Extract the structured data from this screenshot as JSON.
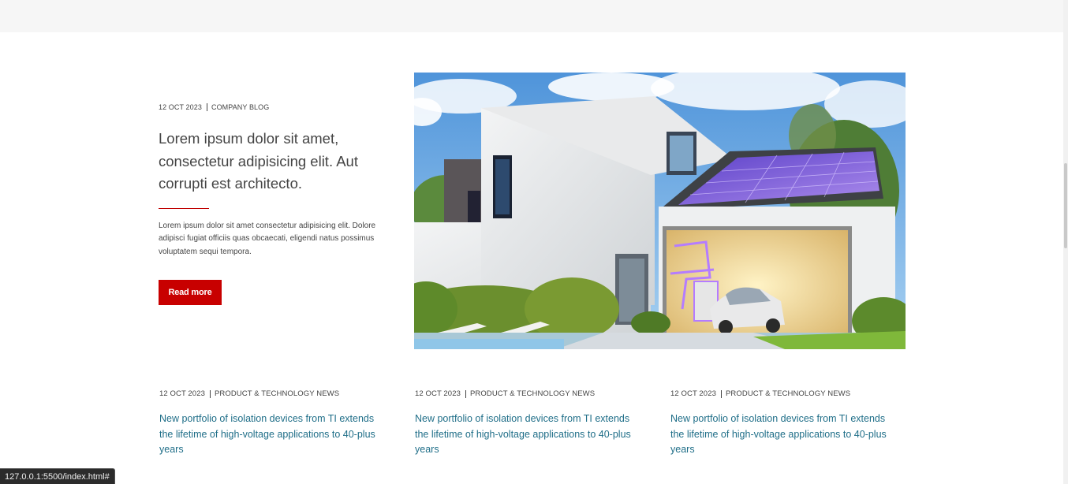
{
  "featured": {
    "date": "12 OCT 2023",
    "category": "COMPANY BLOG",
    "title": "Lorem ipsum dolor sit amet, consectetur adipisicing elit. Aut corrupti est architecto.",
    "excerpt": "Lorem ipsum dolor sit amet consectetur adipisicing elit. Dolore adipisci fugiat officiis quas obcaecati, eligendi natus possimus voluptatem sequi tempora.",
    "button_label": "Read more"
  },
  "news": [
    {
      "date": "12 OCT 2023",
      "category": "PRODUCT & TECHNOLOGY NEWS",
      "title": "New portfolio of isolation devices from TI extends the lifetime of high-voltage applications to 40-plus years"
    },
    {
      "date": "12 OCT 2023",
      "category": "PRODUCT & TECHNOLOGY NEWS",
      "title": "New portfolio of isolation devices from TI extends the lifetime of high-voltage applications to 40-plus years"
    },
    {
      "date": "12 OCT 2023",
      "category": "PRODUCT & TECHNOLOGY NEWS",
      "title": "New portfolio of isolation devices from TI extends the lifetime of high-voltage applications to 40-plus years"
    }
  ],
  "status_bar": {
    "url": "127.0.0.1:5500/index.html#"
  },
  "colors": {
    "accent_red": "#c80000",
    "link_teal": "#1f6e88"
  }
}
